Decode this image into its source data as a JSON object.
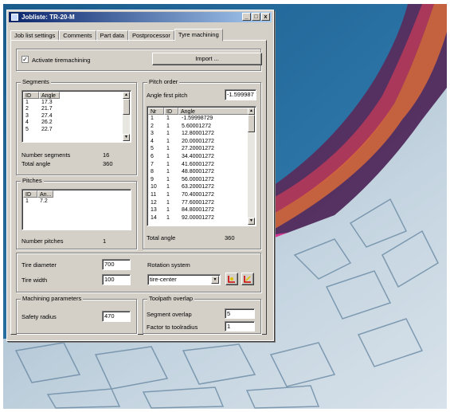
{
  "window": {
    "title": "Jobliste:  TR-20-M",
    "min": "_",
    "max": "□",
    "close": "x"
  },
  "tabs": [
    {
      "label": "Job list settings"
    },
    {
      "label": "Comments"
    },
    {
      "label": "Part data"
    },
    {
      "label": "Postprocessor"
    },
    {
      "label": "Tyre machining"
    }
  ],
  "active_tab": "Tyre machining",
  "activate": {
    "label": "Activate tiremachining",
    "checked": true
  },
  "import_button": "Import ...",
  "segments": {
    "title": "Segments",
    "columns": [
      "ID",
      "Angle"
    ],
    "rows": [
      [
        "1",
        "17.3"
      ],
      [
        "2",
        "21.7"
      ],
      [
        "3",
        "27.4"
      ],
      [
        "4",
        "26.2"
      ],
      [
        "5",
        "22.7"
      ]
    ],
    "number_label": "Number segments",
    "number_value": "16",
    "total_label": "Total angle",
    "total_value": "360"
  },
  "pitches": {
    "title": "Pitches",
    "columns": [
      "ID",
      "An..."
    ],
    "rows": [
      [
        "1",
        "7.2"
      ]
    ],
    "number_label": "Number pitches",
    "number_value": "1"
  },
  "pitch_order": {
    "title": "Pitch order",
    "angle_first_label": "Angle first pitch",
    "angle_first_value": "-1.599987",
    "columns": [
      "Nr",
      "ID",
      "Angle"
    ],
    "rows": [
      [
        "1",
        "1",
        "-1.59998729"
      ],
      [
        "2",
        "1",
        "5.60001272"
      ],
      [
        "3",
        "1",
        "12.80001272"
      ],
      [
        "4",
        "1",
        "20.00001272"
      ],
      [
        "5",
        "1",
        "27.20001272"
      ],
      [
        "6",
        "1",
        "34.40001272"
      ],
      [
        "7",
        "1",
        "41.60001272"
      ],
      [
        "8",
        "1",
        "48.80001272"
      ],
      [
        "9",
        "1",
        "56.00001272"
      ],
      [
        "10",
        "1",
        "63.20001272"
      ],
      [
        "11",
        "1",
        "70.40001272"
      ],
      [
        "12",
        "1",
        "77.60001272"
      ],
      [
        "13",
        "1",
        "84.80001272"
      ],
      [
        "14",
        "1",
        "92.00001272"
      ]
    ],
    "total_label": "Total angle",
    "total_value": "360"
  },
  "tire": {
    "diameter_label": "Tire diameter",
    "diameter_value": "700",
    "width_label": "Tire width",
    "width_value": "100"
  },
  "rotation": {
    "label": "Rotation system",
    "value": "tire-center"
  },
  "machining": {
    "title": "Machining parameters",
    "safety_label": "Safety radius",
    "safety_value": "470"
  },
  "toolpath": {
    "title": "Toolpath overlap",
    "segment_label": "Segment overlap",
    "segment_value": "5",
    "factor_label": "Factor to toolradius",
    "factor_value": "1"
  }
}
